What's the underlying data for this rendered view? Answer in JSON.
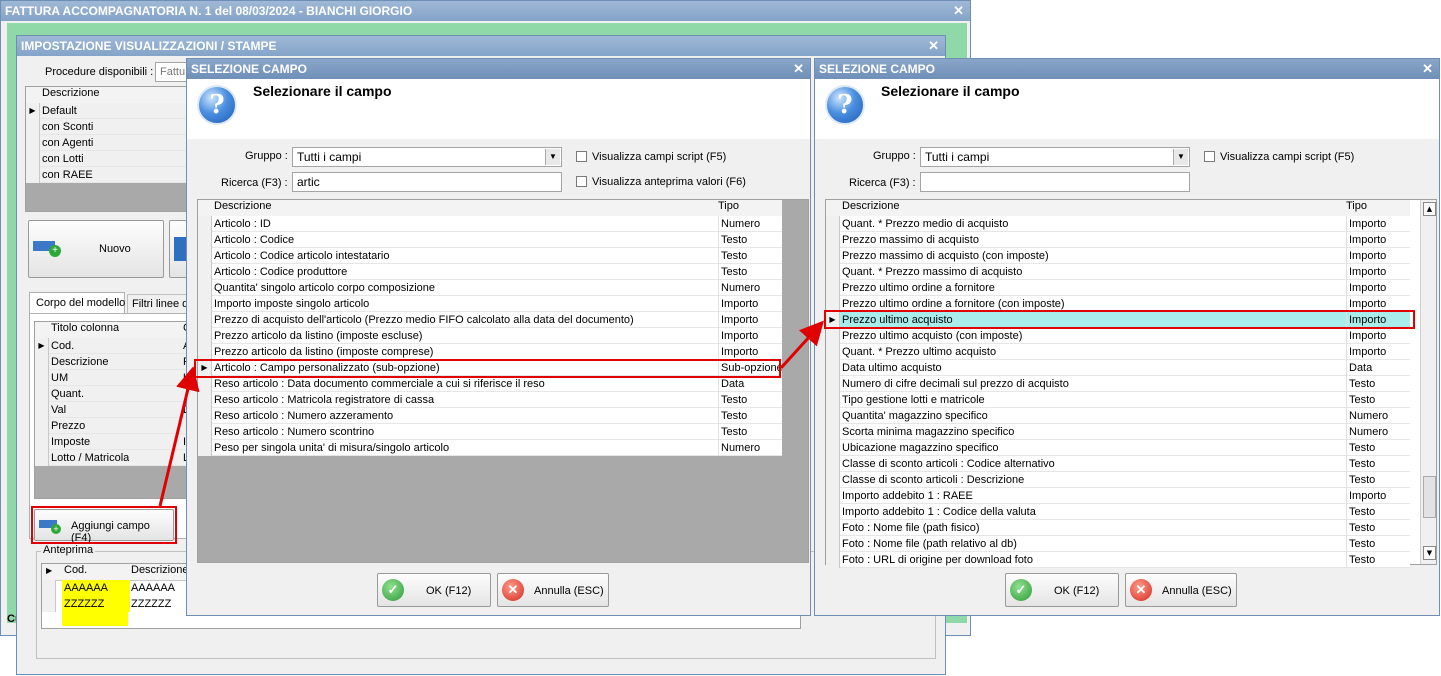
{
  "back_window": {
    "title": "FATTURA ACCOMPAGNATORIA N. 1 del 08/03/2024 - BIANCHI GIORGIO"
  },
  "settings_window": {
    "title": "IMPOSTAZIONE VISUALIZZAZIONI / STAMPE",
    "procedures_label": "Procedure disponibili :",
    "procedures_value": "Fattu",
    "list_header": "Descrizione",
    "list_items": [
      "Default",
      "con Sconti",
      "con Agenti",
      "con Lotti",
      "con RAEE"
    ],
    "new_button": "Nuovo",
    "tabs": [
      "Corpo del modello",
      "Filtri linee d"
    ],
    "columns_header": "Titolo colonna",
    "columns_header2": "C",
    "columns": [
      "Cod.",
      "Descrizione",
      "UM",
      "Quant.",
      "Val",
      "Prezzo",
      "Imposte",
      "Lotto / Matricola"
    ],
    "columns_col2": [
      "A",
      "F",
      "U",
      "",
      "D",
      "",
      "I",
      "L"
    ],
    "add_field_button": "Aggiungi campo (F4)",
    "preview_label": "Anteprima",
    "preview_headers": [
      "Cod.",
      "Descrizione"
    ],
    "preview_rows": [
      [
        "AAAAAA",
        "AAAAAA"
      ],
      [
        "ZZZZZZ",
        "ZZZZZZ"
      ]
    ],
    "highlight_color": "#ffff00"
  },
  "dialog_left": {
    "title": "SELEZIONE CAMPO",
    "heading": "Selezionare il campo",
    "group_label": "Gruppo :",
    "group_value": "Tutti i campi",
    "search_label": "Ricerca (F3) :",
    "search_value": "artic",
    "check_script": "Visualizza campi script (F5)",
    "check_preview": "Visualizza anteprima valori (F6)",
    "header_desc": "Descrizione",
    "header_type": "Tipo",
    "rows": [
      {
        "desc": "Articolo : ID",
        "type": "Numero"
      },
      {
        "desc": "Articolo : Codice",
        "type": "Testo"
      },
      {
        "desc": "Articolo : Codice articolo intestatario",
        "type": "Testo"
      },
      {
        "desc": "Articolo : Codice produttore",
        "type": "Testo"
      },
      {
        "desc": "Quantita' singolo articolo corpo composizione",
        "type": "Numero"
      },
      {
        "desc": "Importo imposte singolo articolo",
        "type": "Importo"
      },
      {
        "desc": "Prezzo di acquisto dell'articolo (Prezzo medio FIFO calcolato alla data del documento)",
        "type": "Importo"
      },
      {
        "desc": "Prezzo articolo da listino (imposte escluse)",
        "type": "Importo"
      },
      {
        "desc": "Prezzo articolo da listino (imposte comprese)",
        "type": "Importo"
      },
      {
        "desc": "Articolo : Campo personalizzato (sub-opzione)",
        "type": "Sub-opzione"
      },
      {
        "desc": "Reso articolo : Data documento commerciale a cui si riferisce il reso",
        "type": "Data"
      },
      {
        "desc": "Reso articolo : Matricola registratore di cassa",
        "type": "Testo"
      },
      {
        "desc": "Reso articolo : Numero azzeramento",
        "type": "Testo"
      },
      {
        "desc": "Reso articolo : Numero scontrino",
        "type": "Testo"
      },
      {
        "desc": "Peso per singola unita' di misura/singolo articolo",
        "type": "Numero"
      }
    ],
    "ok_button": "OK (F12)",
    "cancel_button": "Annulla (ESC)"
  },
  "dialog_right": {
    "title": "SELEZIONE CAMPO",
    "heading": "Selezionare il campo",
    "group_label": "Gruppo :",
    "group_value": "Tutti i campi",
    "search_label": "Ricerca (F3) :",
    "search_value": "",
    "check_script": "Visualizza campi script (F5)",
    "header_desc": "Descrizione",
    "header_type": "Tipo",
    "rows": [
      {
        "desc": "Quant. * Prezzo medio di acquisto",
        "type": "Importo"
      },
      {
        "desc": "Prezzo massimo di acquisto",
        "type": "Importo"
      },
      {
        "desc": "Prezzo massimo di acquisto (con imposte)",
        "type": "Importo"
      },
      {
        "desc": "Quant. * Prezzo massimo di acquisto",
        "type": "Importo"
      },
      {
        "desc": "Prezzo ultimo ordine a fornitore",
        "type": "Importo"
      },
      {
        "desc": "Prezzo ultimo ordine a fornitore (con imposte)",
        "type": "Importo"
      },
      {
        "desc": "Prezzo ultimo acquisto",
        "type": "Importo"
      },
      {
        "desc": "Prezzo ultimo acquisto (con imposte)",
        "type": "Importo"
      },
      {
        "desc": "Quant. * Prezzo ultimo acquisto",
        "type": "Importo"
      },
      {
        "desc": "Data ultimo acquisto",
        "type": "Data"
      },
      {
        "desc": "Numero di cifre decimali sul prezzo di acquisto",
        "type": "Testo"
      },
      {
        "desc": "Tipo gestione lotti e matricole",
        "type": "Testo"
      },
      {
        "desc": "Quantita' magazzino specifico",
        "type": "Numero"
      },
      {
        "desc": "Scorta minima magazzino specifico",
        "type": "Numero"
      },
      {
        "desc": "Ubicazione magazzino specifico",
        "type": "Testo"
      },
      {
        "desc": "Classe di sconto articoli : Codice alternativo",
        "type": "Testo"
      },
      {
        "desc": "Classe di sconto articoli : Descrizione",
        "type": "Testo"
      },
      {
        "desc": "Importo addebito 1 : RAEE",
        "type": "Importo"
      },
      {
        "desc": "Importo addebito 1 : Codice della valuta",
        "type": "Testo"
      },
      {
        "desc": "Foto : Nome file (path fisico)",
        "type": "Testo"
      },
      {
        "desc": "Foto : Nome file (path relativo al db)",
        "type": "Testo"
      },
      {
        "desc": "Foto : URL di origine per download foto",
        "type": "Testo"
      }
    ],
    "ok_button": "OK (F12)",
    "cancel_button": "Annulla (ESC)",
    "selected_color": "#a8ecec"
  },
  "accent_red": "#e00000"
}
